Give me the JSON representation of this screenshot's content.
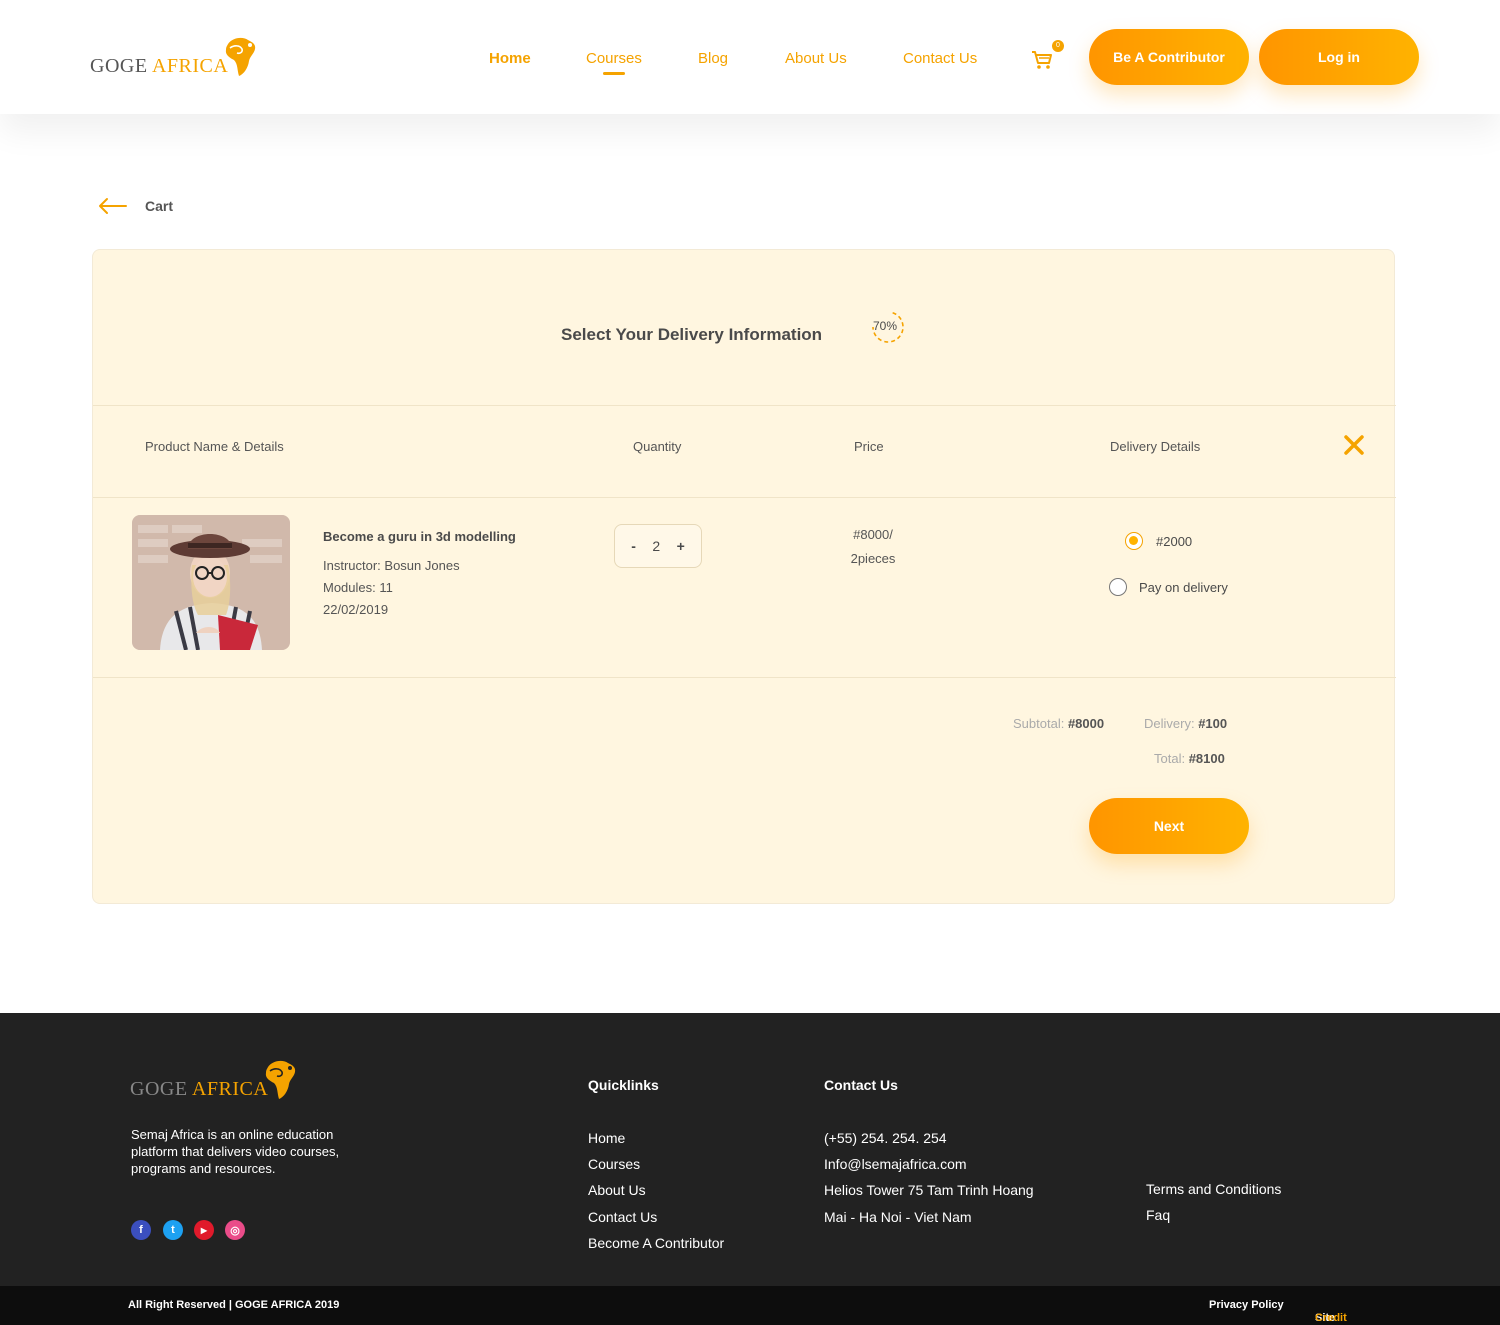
{
  "header": {
    "logo": {
      "word1": "GOGE",
      "word2": "AFRICA"
    },
    "nav": [
      {
        "label": "Home"
      },
      {
        "label": "Courses"
      },
      {
        "label": "Blog"
      },
      {
        "label": "About Us"
      },
      {
        "label": "Contact Us"
      }
    ],
    "cart_count": "0",
    "contributor_label": "Be A Contributor",
    "login_label": "Log in"
  },
  "back": {
    "label": "Cart"
  },
  "checkout": {
    "title": "Select Your Delivery Information",
    "progress_label": "70%",
    "progress_value": 0.7,
    "columns": [
      "Product Name & Details",
      "Quantity",
      "Price",
      "Delivery Details"
    ],
    "item": {
      "title": "Become a guru in 3d modelling",
      "instructor": "Instructor: Bosun Jones",
      "modules": "Modules: 11",
      "date": "22/02/2019",
      "quantity": "2",
      "minus": "-",
      "plus": "+",
      "price_line1": "#8000/",
      "price_line2": "2pieces"
    },
    "delivery_options": [
      {
        "label": "#2000",
        "selected": true
      },
      {
        "label": "Pay on delivery",
        "selected": false
      }
    ],
    "subtotal_label": "Subtotal:",
    "subtotal_value": "#8000",
    "delivery_label": "Delivery:",
    "delivery_value": "#100",
    "total_label": "Total:",
    "total_value": "#8100",
    "next_label": "Next"
  },
  "footer": {
    "logo": {
      "word1": "GOGE",
      "word2": "AFRICA"
    },
    "description": "Semaj Africa is an online education platform that delivers video courses, programs and resources.",
    "social": [
      {
        "icon": "facebook-icon",
        "glyph": "f",
        "color": "#3b4fbf"
      },
      {
        "icon": "twitter-icon",
        "glyph": "t",
        "color": "#1da1f2"
      },
      {
        "icon": "youtube-icon",
        "glyph": "▶",
        "color": "#e01a2b"
      },
      {
        "icon": "dribbble-icon",
        "glyph": "◎",
        "color": "#ea4c89"
      }
    ],
    "quicklinks_title": "Quicklinks",
    "quicklinks": [
      "Home",
      "Courses",
      "About Us",
      "Contact Us",
      "Become A Contributor"
    ],
    "contact_title": "Contact Us",
    "contact": [
      "(+55) 254. 254. 254",
      "Info@lsemajafrica.com",
      "Helios Tower 75 Tam Trinh Hoang",
      "Mai - Ha Noi - Viet Nam"
    ],
    "legal": [
      "Terms and Conditions",
      "Faq"
    ]
  },
  "bottom_bar": {
    "copyright": "All Right Reserved | GOGE AFRICA 2019",
    "privacy": "Privacy Policy",
    "site": "Site",
    "credit": "Credit"
  },
  "colors": {
    "accent": "#f5a300",
    "panel": "#fff6e0",
    "footer": "#222222"
  }
}
